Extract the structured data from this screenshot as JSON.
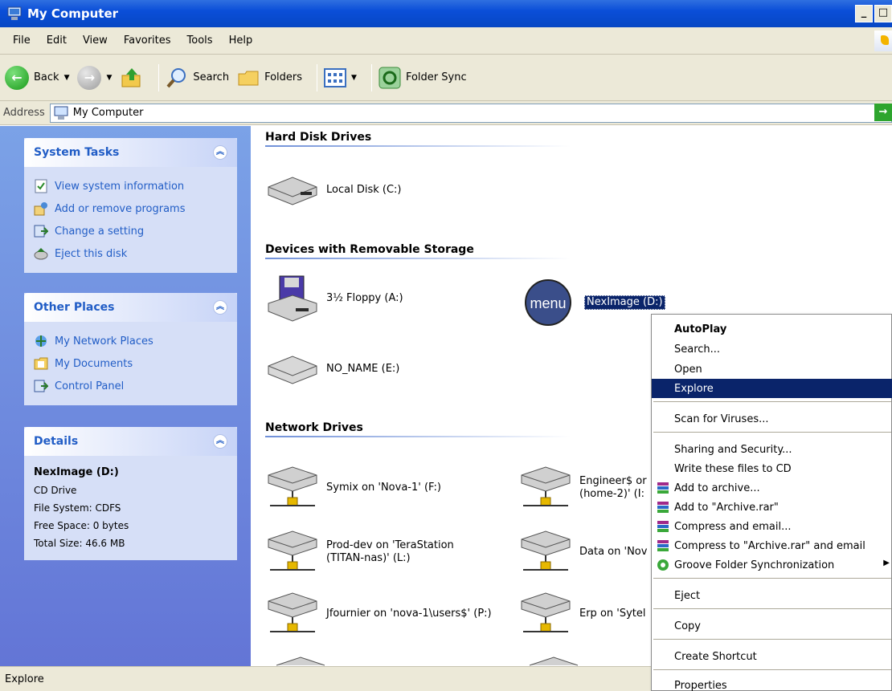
{
  "window": {
    "title": "My Computer"
  },
  "menubar": [
    "File",
    "Edit",
    "View",
    "Favorites",
    "Tools",
    "Help"
  ],
  "toolbar": {
    "back_label": "Back",
    "search_label": "Search",
    "folders_label": "Folders",
    "foldersync_label": "Folder Sync"
  },
  "address": {
    "label": "Address",
    "value": "My Computer"
  },
  "system_tasks": {
    "title": "System Tasks",
    "items": [
      "View system information",
      "Add or remove programs",
      "Change a setting",
      "Eject this disk"
    ]
  },
  "other_places": {
    "title": "Other Places",
    "items": [
      "My Network Places",
      "My Documents",
      "Control Panel"
    ]
  },
  "details": {
    "title": "Details",
    "name": "NexImage (D:)",
    "type": "CD Drive",
    "filesystem": "File System: CDFS",
    "freespace": "Free Space: 0 bytes",
    "totalsize": "Total Size: 46.6 MB"
  },
  "sections": {
    "hard_disk": "Hard Disk Drives",
    "removable": "Devices with Removable Storage",
    "network": "Network Drives"
  },
  "drives": {
    "local_c": "Local Disk (C:)",
    "floppy": "3½ Floppy (A:)",
    "neximage": "NexImage (D:)",
    "neximage_icon_text": "menu",
    "noname": "NO_NAME (E:)"
  },
  "network_drives": {
    "symix": "Symix on 'Nova-1' (F:)",
    "engineer": "Engineer$ or",
    "engineer2": "(home-2)' (I:",
    "proddev": "Prod-dev on 'TeraStation",
    "proddev2": "(TITAN-nas)' (L:)",
    "data": "Data on 'Nov",
    "jfournier": "Jfournier on 'nova-1\\users$' (P:)",
    "erp": "Erp on 'Sytel"
  },
  "context_menu": {
    "autoplay": "AutoPlay",
    "search": "Search...",
    "open": "Open",
    "explore": "Explore",
    "scan": "Scan for Viruses...",
    "sharing": "Sharing and Security...",
    "writecd": "Write these files to CD",
    "addarchive": "Add to archive...",
    "addrar": "Add to \"Archive.rar\"",
    "compressemail": "Compress and email...",
    "compressrar": "Compress to \"Archive.rar\" and email",
    "groove": "Groove Folder Synchronization",
    "eject": "Eject",
    "copy": "Copy",
    "shortcut": "Create Shortcut",
    "properties": "Properties"
  },
  "status": {
    "text": "Explore"
  }
}
